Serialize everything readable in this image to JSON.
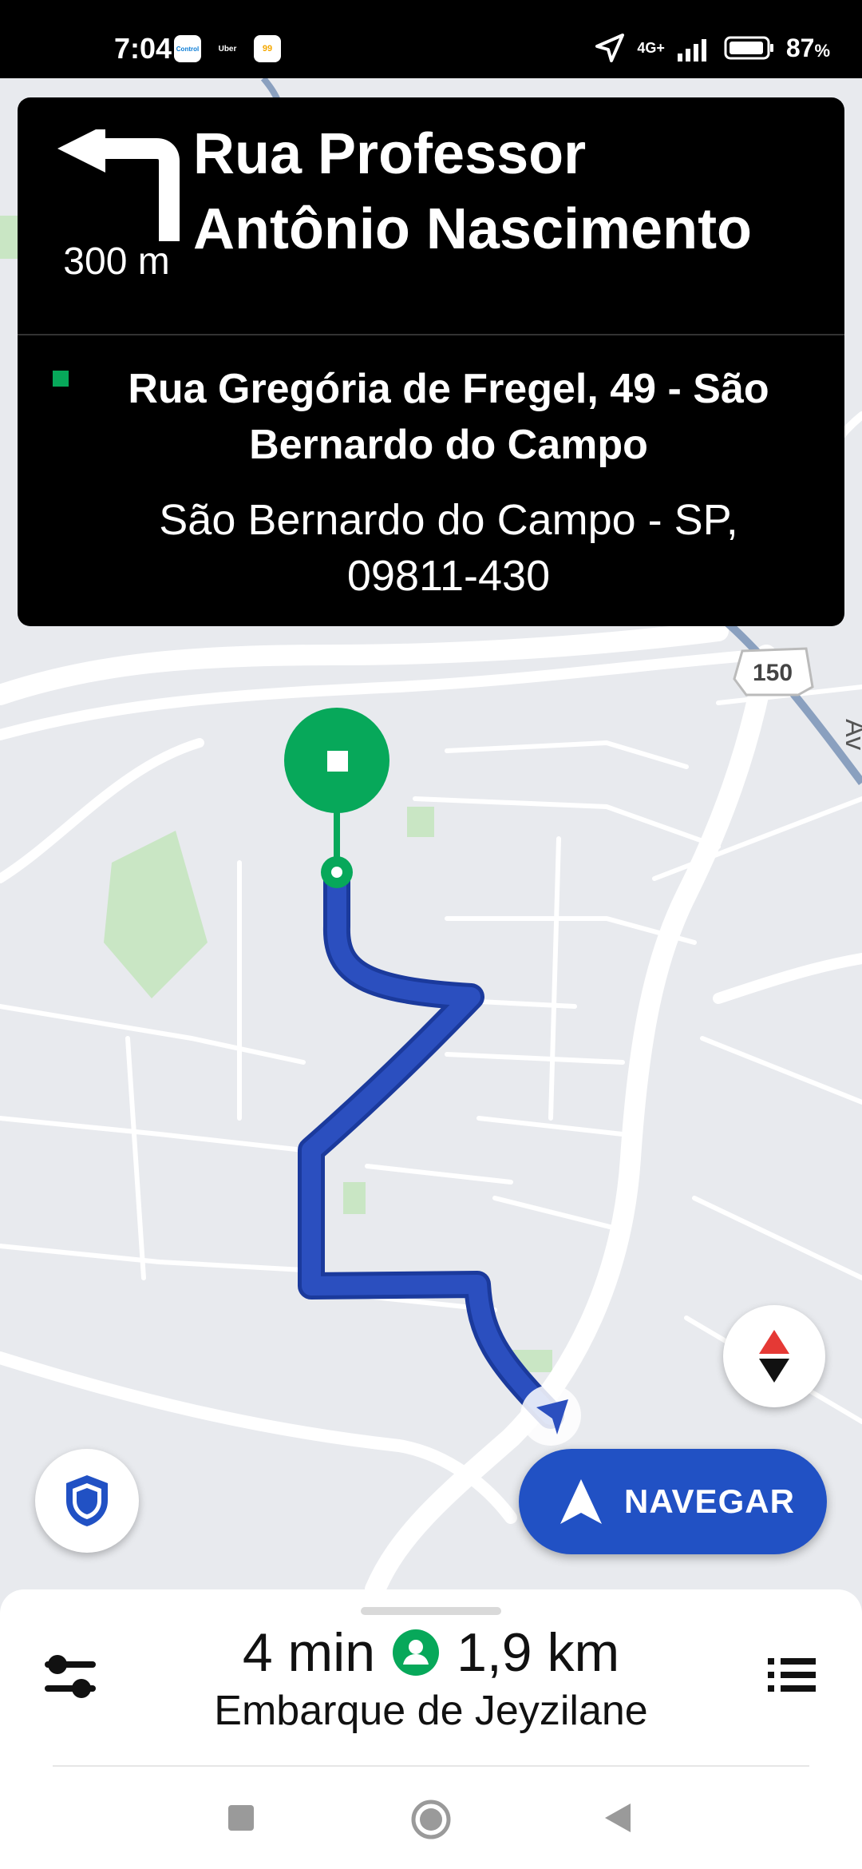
{
  "status_bar": {
    "time": "7:04",
    "app_icons": [
      "Control",
      "Uber",
      "99"
    ],
    "network": "4G+",
    "battery": "87",
    "battery_unit": "%"
  },
  "navigation": {
    "turn_direction": "left",
    "turn_distance": "300 m",
    "street_name": "Rua Professor Antônio Nascimento",
    "destination_title": "Rua Gregória de Fregel, 49 - São Bernardo do Campo",
    "destination_subtitle": "São Bernardo do Campo - SP, 09811-430"
  },
  "map": {
    "road_shield": "150",
    "edge_label": "Av",
    "route_color": "#2b4fbf",
    "destination_color": "#07a85a"
  },
  "actions": {
    "navigate_label": "NAVEGAR",
    "shield_icon": "shield-icon",
    "compass_icon": "compass-icon"
  },
  "trip": {
    "eta": "4 min",
    "distance": "1,9 km",
    "pickup_label": "Embarque de Jeyzilane"
  },
  "colors": {
    "accent": "#2151c4",
    "green": "#07a85a"
  }
}
